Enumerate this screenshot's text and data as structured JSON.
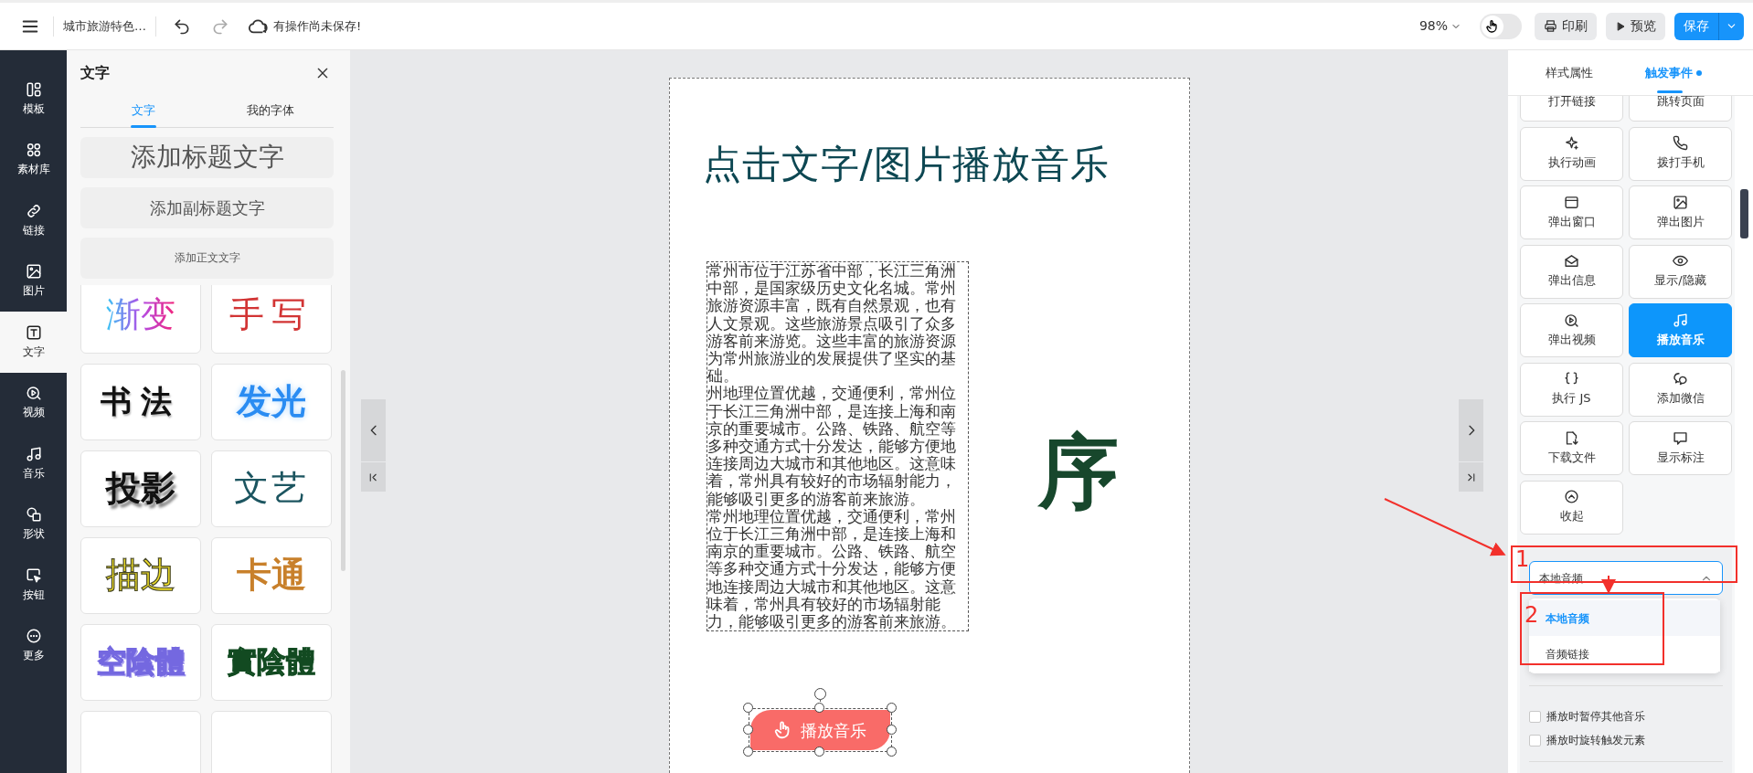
{
  "top_bar": {
    "title": "城市旅游特色…",
    "undo": {
      "disabled": false
    },
    "redo": {
      "disabled": true
    },
    "save_status": "有操作尚未保存!",
    "zoom": "98%",
    "touch_toggle": {
      "on": false
    },
    "buttons": [
      {
        "label": "印刷",
        "kind": "print"
      },
      {
        "label": "预览",
        "kind": "preview"
      },
      {
        "label": "保存",
        "kind": "save"
      }
    ]
  },
  "rail": [
    {
      "label": "模板",
      "selected": false
    },
    {
      "label": "素材库",
      "selected": false
    },
    {
      "label": "链接",
      "selected": false
    },
    {
      "label": "图片",
      "selected": false
    },
    {
      "label": "文字",
      "selected": true
    },
    {
      "label": "视频",
      "selected": false
    },
    {
      "label": "音乐",
      "selected": false
    },
    {
      "label": "形状",
      "selected": false
    },
    {
      "label": "按钮",
      "selected": false
    },
    {
      "label": "更多",
      "selected": false
    }
  ],
  "text_panel": {
    "title": "文字",
    "tabs": [
      {
        "label": "文字",
        "selected": true
      },
      {
        "label": "我的字体",
        "selected": false
      }
    ],
    "add_buttons": [
      {
        "label": "添加标题文字",
        "kind": "title"
      },
      {
        "label": "添加副标题文字",
        "kind": "subtitle"
      },
      {
        "label": "添加正文文字",
        "kind": "body"
      }
    ],
    "styles": [
      {
        "label": "渐变",
        "kind": "gradient"
      },
      {
        "label": "手写",
        "kind": "handwriting"
      },
      {
        "label": "书法",
        "kind": "calligraphy"
      },
      {
        "label": "发光",
        "kind": "glow"
      },
      {
        "label": "投影",
        "kind": "shadow"
      },
      {
        "label": "文艺",
        "kind": "literary"
      },
      {
        "label": "描边",
        "kind": "stroke"
      },
      {
        "label": "卡通",
        "kind": "cartoon"
      },
      {
        "label": "空陰體",
        "kind": "hollow"
      },
      {
        "label": "實陰體",
        "kind": "solid"
      },
      {
        "kind": "cut"
      },
      {
        "kind": "cut"
      }
    ]
  },
  "canvas": {
    "title": "点击文字/图片播放音乐",
    "paragraphs": [
      "常州市位于江苏省中部，长江三角洲中部，是国家级历史文化名城。常州旅游资源丰富，既有自然景观，也有人文景观。这些旅游景点吸引了众多游客前来游览。这些丰富的旅游资源为常州旅游业的发展提供了坚实的基础。",
      "州地理位置优越，交通便利，常州位于长江三角洲中部，是连接上海和南京的重要城市。公路、铁路、航空等多种交通方式十分发达，能够方便地连接周边大城市和其他地区。这意味着，常州具有较好的市场辐射能力，能够吸引更多的游客前来旅游。",
      "常州地理位置优越，交通便利，常州位于长江三角洲中部，是连接上海和南京的重要城市。公路、铁路、航空等多种交通方式十分发达，能够方便地连接周边大城市和其他地区。这意味着，常州具有较好的市场辐射能力，能够吸引更多的游客前来旅游。"
    ],
    "calligraphy": "序",
    "button": {
      "label": "播放音乐",
      "selected": true
    }
  },
  "right_panel": {
    "tabs": [
      {
        "label": "样式属性",
        "selected": false,
        "dot": false
      },
      {
        "label": "触发事件",
        "selected": true,
        "dot": true
      }
    ],
    "actions": [
      {
        "label": "打开链接",
        "kind": "cut",
        "selected": false
      },
      {
        "label": "跳转页面",
        "kind": "cut",
        "selected": false
      },
      {
        "label": "执行动画",
        "kind": "full",
        "selected": false
      },
      {
        "label": "拨打手机",
        "kind": "full",
        "selected": false
      },
      {
        "label": "弹出窗口",
        "kind": "full",
        "selected": false
      },
      {
        "label": "弹出图片",
        "kind": "full",
        "selected": false
      },
      {
        "label": "弹出信息",
        "kind": "full",
        "selected": false
      },
      {
        "label": "显示/隐藏",
        "kind": "full",
        "selected": false
      },
      {
        "label": "弹出视频",
        "kind": "full",
        "selected": false
      },
      {
        "label": "播放音乐",
        "kind": "full",
        "selected": true
      },
      {
        "label": "执行 JS",
        "kind": "full",
        "selected": false
      },
      {
        "label": "添加微信",
        "kind": "full",
        "selected": false
      },
      {
        "label": "下载文件",
        "kind": "full",
        "selected": false
      },
      {
        "label": "显示标注",
        "kind": "full",
        "selected": false
      },
      {
        "label": "收起",
        "kind": "full",
        "selected": false
      }
    ],
    "audio_select": {
      "value": "本地音频",
      "expanded": true,
      "options": [
        {
          "label": "本地音频",
          "selected": true
        },
        {
          "label": "音频链接",
          "selected": false
        }
      ]
    },
    "options": [
      {
        "label": "播放时暂停其他音乐",
        "checked": false
      },
      {
        "label": "播放时旋转触发元素",
        "checked": false
      }
    ]
  },
  "annotations": [
    {
      "label": "1"
    },
    {
      "label": "2"
    }
  ]
}
